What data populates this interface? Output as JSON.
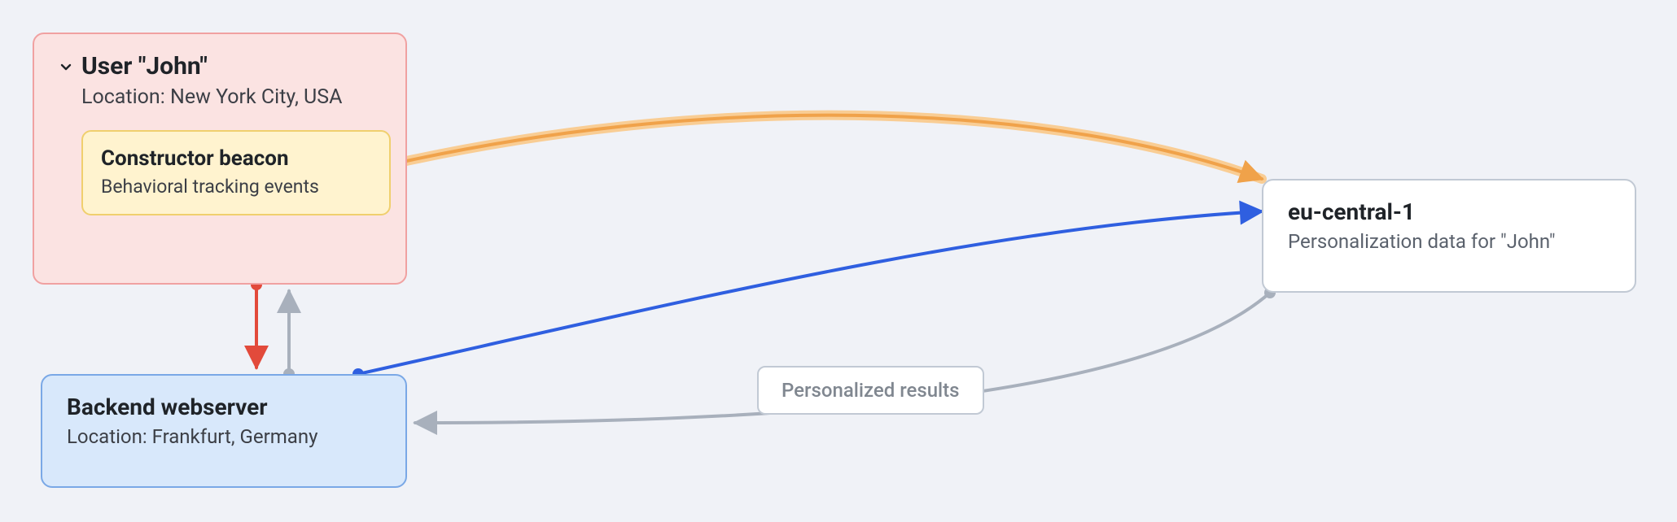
{
  "nodes": {
    "user": {
      "title": "User \"John\"",
      "subtitle": "Location: New York City, USA",
      "beacon": {
        "title": "Constructor beacon",
        "subtitle": "Behavioral tracking events"
      }
    },
    "backend": {
      "title": "Backend webserver",
      "subtitle": "Location: Frankfurt, Germany"
    },
    "region": {
      "title": "eu-central-1",
      "subtitle": "Personalization data for \"John\""
    }
  },
  "edges": {
    "beacon_to_region": {
      "color": "#f0a24a"
    },
    "backend_to_region_request": {
      "color": "#2f5fe0"
    },
    "region_to_backend_response": {
      "color": "#a8b0bc",
      "label": "Personalized results"
    },
    "user_to_backend": {
      "color": "#e24a3b"
    },
    "backend_to_user": {
      "color": "#a8b0bc"
    }
  },
  "colors": {
    "user_bg": "#fbe3e2",
    "user_border": "#f0a1a1",
    "beacon_bg": "#fff3cf",
    "beacon_border": "#f0cf6e",
    "backend_bg": "#d8e8fb",
    "backend_border": "#7aa8e6",
    "region_bg": "#ffffff",
    "region_border": "#c1c9d4",
    "canvas_bg": "#f0f2f7"
  }
}
